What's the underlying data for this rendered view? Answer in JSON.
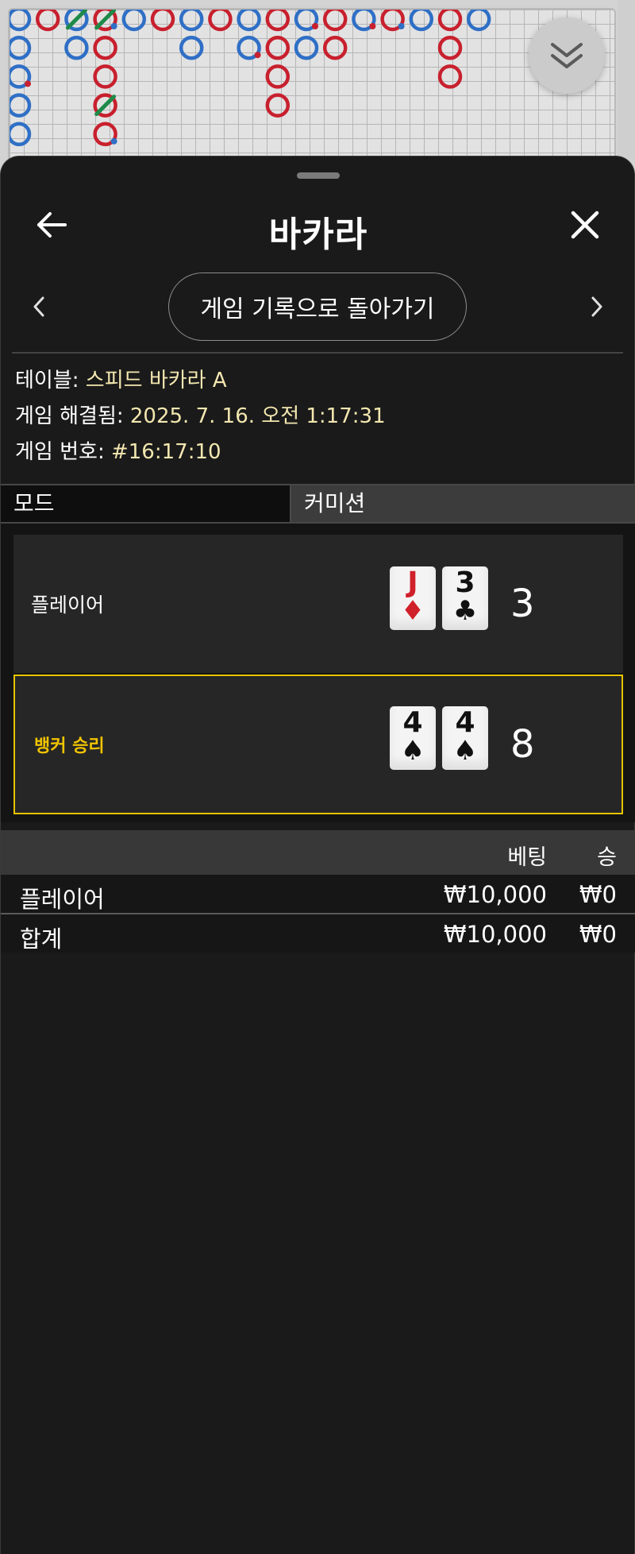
{
  "roadmap": {
    "cells": [
      {
        "c": 0,
        "r": 0,
        "t": "P"
      },
      {
        "c": 1,
        "r": 0,
        "t": "B"
      },
      {
        "c": 2,
        "r": 0,
        "t": "P",
        "slash": true
      },
      {
        "c": 3,
        "r": 0,
        "t": "B",
        "slash": true,
        "dot": true
      },
      {
        "c": 4,
        "r": 0,
        "t": "P"
      },
      {
        "c": 5,
        "r": 0,
        "t": "B"
      },
      {
        "c": 6,
        "r": 0,
        "t": "P"
      },
      {
        "c": 7,
        "r": 0,
        "t": "B"
      },
      {
        "c": 8,
        "r": 0,
        "t": "P"
      },
      {
        "c": 9,
        "r": 0,
        "t": "B"
      },
      {
        "c": 10,
        "r": 0,
        "t": "P",
        "dot": true
      },
      {
        "c": 11,
        "r": 0,
        "t": "B"
      },
      {
        "c": 12,
        "r": 0,
        "t": "P",
        "dot": true
      },
      {
        "c": 13,
        "r": 0,
        "t": "B",
        "dot": true
      },
      {
        "c": 14,
        "r": 0,
        "t": "P"
      },
      {
        "c": 15,
        "r": 0,
        "t": "B"
      },
      {
        "c": 16,
        "r": 0,
        "t": "P"
      },
      {
        "c": 0,
        "r": 1,
        "t": "P"
      },
      {
        "c": 2,
        "r": 1,
        "t": "P"
      },
      {
        "c": 3,
        "r": 1,
        "t": "B"
      },
      {
        "c": 6,
        "r": 1,
        "t": "P"
      },
      {
        "c": 8,
        "r": 1,
        "t": "P",
        "dot": true
      },
      {
        "c": 9,
        "r": 1,
        "t": "B"
      },
      {
        "c": 10,
        "r": 1,
        "t": "P"
      },
      {
        "c": 11,
        "r": 1,
        "t": "B"
      },
      {
        "c": 15,
        "r": 1,
        "t": "B"
      },
      {
        "c": 0,
        "r": 2,
        "t": "P",
        "dot": true
      },
      {
        "c": 3,
        "r": 2,
        "t": "B"
      },
      {
        "c": 9,
        "r": 2,
        "t": "B"
      },
      {
        "c": 15,
        "r": 2,
        "t": "B"
      },
      {
        "c": 0,
        "r": 3,
        "t": "P"
      },
      {
        "c": 3,
        "r": 3,
        "t": "B",
        "slash": true
      },
      {
        "c": 9,
        "r": 3,
        "t": "B"
      },
      {
        "c": 0,
        "r": 4,
        "t": "P"
      },
      {
        "c": 3,
        "r": 4,
        "t": "B",
        "dot": true
      }
    ],
    "colors": {
      "P": "#2f6fc6",
      "B": "#c8202e",
      "tie": "#1e8a4a"
    }
  },
  "header": {
    "title": "바카라"
  },
  "nav": {
    "back_to_history_label": "게임 기록으로 돌아가기"
  },
  "info": {
    "table_label": "테이블:",
    "table_value": "스피드 바카라 A",
    "resolved_label": "게임 해결됨:",
    "resolved_value": "2025. 7. 16. 오전 1:17:31",
    "game_no_label": "게임 번호:",
    "game_no_value": "#16:17:10"
  },
  "mode_bar": {
    "mode_label": "모드",
    "commission_label": "커미션"
  },
  "results": {
    "player": {
      "label": "플레이어",
      "cards": [
        {
          "rank": "J",
          "suit": "♦",
          "color": "red"
        },
        {
          "rank": "3",
          "suit": "♣",
          "color": "black"
        }
      ],
      "total": "3"
    },
    "banker": {
      "label": "뱅커 승리",
      "cards": [
        {
          "rank": "4",
          "suit": "♠",
          "color": "black"
        },
        {
          "rank": "4",
          "suit": "♠",
          "color": "black"
        }
      ],
      "total": "8"
    }
  },
  "bets": {
    "col_bet": "베팅",
    "col_win": "승",
    "rows": [
      {
        "name": "플레이어",
        "bet": "₩10,000",
        "win": "₩0"
      },
      {
        "name": "합계",
        "bet": "₩10,000",
        "win": "₩0"
      }
    ]
  },
  "icons": {
    "back": "arrow-left-icon",
    "close": "close-icon",
    "prev": "chevron-left-icon",
    "next": "chevron-right-icon",
    "collapse": "double-chevron-down-icon"
  }
}
